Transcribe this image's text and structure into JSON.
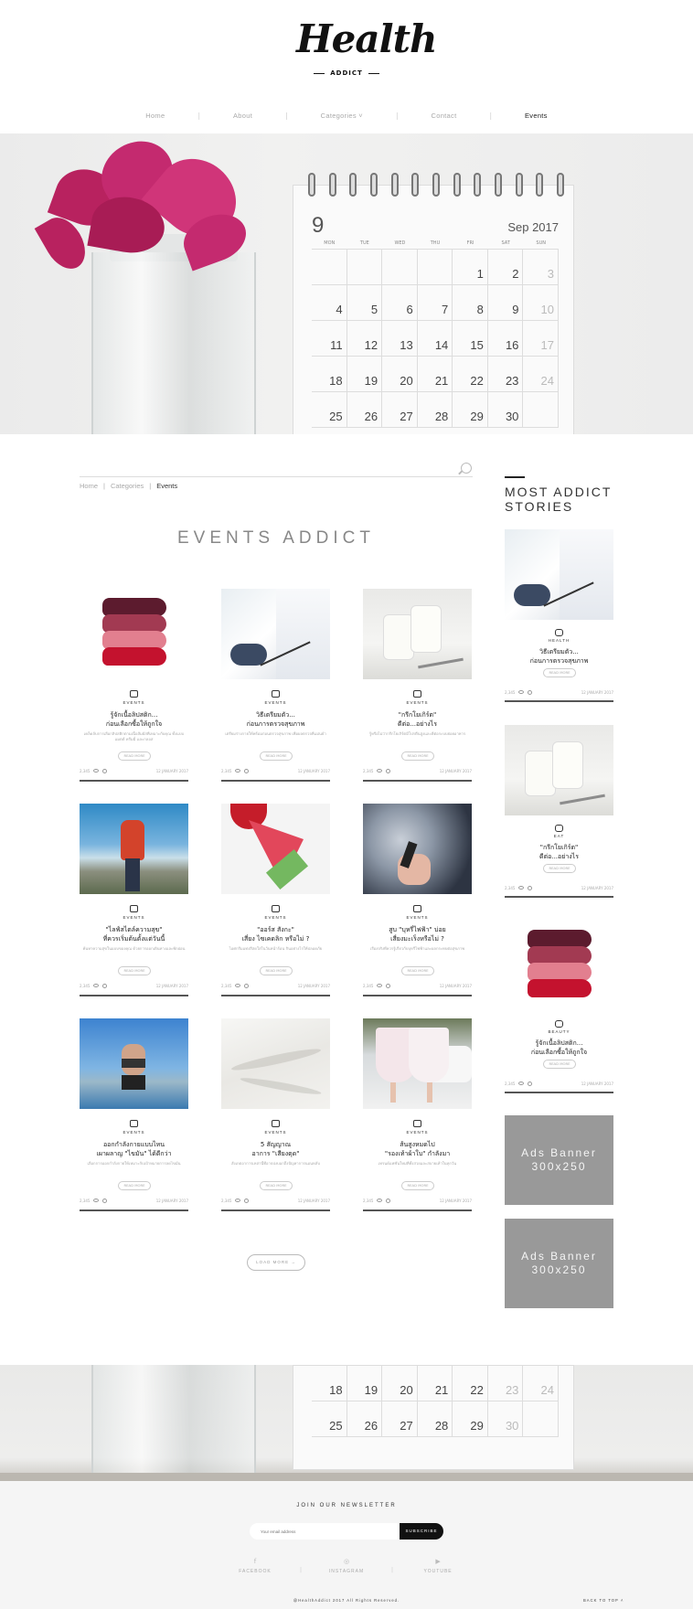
{
  "brand": {
    "logo_script": "Health",
    "logo_sub": "ADDICT"
  },
  "nav": {
    "items": [
      {
        "label": "Home"
      },
      {
        "label": "About"
      },
      {
        "label": "Categories ˅"
      },
      {
        "label": "Contact"
      },
      {
        "label": "Events"
      }
    ],
    "separator": "|",
    "active": "Events"
  },
  "hero": {
    "calendar_number": "9",
    "calendar_month": "Sep 2017",
    "weekdays": [
      "MON",
      "TUE",
      "WED",
      "THU",
      "FRI",
      "SAT",
      "SUN"
    ],
    "days": [
      "",
      "",
      "",
      "",
      "1",
      "2",
      "3",
      "4",
      "5",
      "6",
      "7",
      "8",
      "9",
      "10",
      "11",
      "12",
      "13",
      "14",
      "15",
      "16",
      "17",
      "18",
      "19",
      "20",
      "21",
      "22",
      "23",
      "24",
      "25",
      "26",
      "27",
      "28",
      "29",
      "30",
      ""
    ]
  },
  "breadcrumb": {
    "home": "Home",
    "sep": "|",
    "categories": "Categories",
    "current": "Events"
  },
  "section_title": "EVENTS ADDICT",
  "cards": [
    {
      "category": "EVENTS",
      "title1": "รู้จักเนื้อลิปสติก...",
      "title2": "ก่อนเลือกซื้อให้ถูกใจ",
      "excerpt": "เคล็ดลับการเลือกลิปสติกตามเนื้อสัมผัสที่เหมาะกับคุณ ทั้งแบบแมตต์ ครีมมี่ และกลอส",
      "read": "READ MORE",
      "views": "2,345",
      "date": "12 JANUARY 2017"
    },
    {
      "category": "EVENTS",
      "title1": "วิธีเตรียมตัว...",
      "title2": "ก่อนการตรวจสุขภาพ",
      "excerpt": "เตรียมร่างกายให้พร้อมก่อนตรวจสุขภาพ เพื่อผลตรวจที่แม่นยำ",
      "read": "READ MORE",
      "views": "2,345",
      "date": "12 JANUARY 2017"
    },
    {
      "category": "EVENTS",
      "title1": "\"กรีกโยเกิร์ต\"",
      "title2": "ดีต่อ...อย่างไร",
      "excerpt": "รู้หรือไม่ว่ากรีกโยเกิร์ตมีโปรตีนสูงและดีต่อระบบย่อยอาหาร",
      "read": "READ MORE",
      "views": "2,345",
      "date": "12 JANUARY 2017"
    },
    {
      "category": "EVENTS",
      "title1": "\"ไลฟ์สไตล์ความสุข\"",
      "title2": "ที่ควรเริ่มต้นตั้งแต่วันนี้",
      "excerpt": "ค้นหาความสุขในแบบของคุณ ด้วยการออกเดินทางและพักผ่อน",
      "read": "READ MORE",
      "views": "2,345",
      "date": "12 JANUARY 2017"
    },
    {
      "category": "EVENTS",
      "title1": "\"ออร์ส สังกะ\"",
      "title2": "เสี่ยง ไซเคดลิก หรือไม่ ?",
      "excerpt": "ไอศกรีมแท่งสีสดใสในวันหน้าร้อน กินอย่างไรให้ปลอดภัย",
      "read": "READ MORE",
      "views": "2,345",
      "date": "12 JANUARY 2017"
    },
    {
      "category": "EVENTS",
      "title1": "สูบ \"บุหรี่ไฟฟ้า\" บ่อย",
      "title2": "เสี่ยงมะเร็งหรือไม่ ?",
      "excerpt": "เรื่องจริงที่ควรรู้เกี่ยวกับบุหรี่ไฟฟ้าและผลกระทบต่อสุขภาพ",
      "read": "READ MORE",
      "views": "2,345",
      "date": "12 JANUARY 2017"
    },
    {
      "category": "EVENTS",
      "title1": "ออกกำลังกายแบบไหน",
      "title2": "เผาผลาญ \"ไขมัน\" ได้ดีกว่า",
      "excerpt": "เลือกการออกกำลังกายให้เหมาะกับเป้าหมายการลดไขมัน",
      "read": "READ MORE",
      "views": "2,345",
      "date": "12 JANUARY 2017"
    },
    {
      "category": "EVENTS",
      "title1": "5 สัญญาณ",
      "title2": "อาการ \"เสียงตุด\"",
      "excerpt": "สังเกตอาการเหล่านี้ที่อาจบ่งบอกถึงปัญหาการนอนหลับ",
      "read": "READ MORE",
      "views": "2,345",
      "date": "12 JANUARY 2017"
    },
    {
      "category": "EVENTS",
      "title1": "ส้นสูงหมดไป",
      "title2": "\"รองเท้าผ้าใบ\" กำลังมา",
      "excerpt": "เทรนด์แฟชั่นใหม่ที่ทั้งสวยและสบายเท้าในทุกวัน",
      "read": "READ MORE",
      "views": "2,345",
      "date": "12 JANUARY 2017"
    }
  ],
  "load_more": "LOAD MORE →",
  "sidebar": {
    "title_line1": "MOST ADDICT",
    "title_line2": "STORIES",
    "stories": [
      {
        "category": "HEALTH",
        "title1": "วิธีเตรียมตัว...",
        "title2": "ก่อนการตรวจสุขภาพ",
        "read": "READ MORE",
        "views": "2,345",
        "date": "12 JANUARY 2017"
      },
      {
        "category": "EAT",
        "title1": "\"กรีกโยเกิร์ต\"",
        "title2": "ดีต่อ...อย่างไร",
        "read": "READ MORE",
        "views": "2,345",
        "date": "12 JANUARY 2017"
      },
      {
        "category": "BEAUTY",
        "title1": "รู้จักเนื้อลิปสติก...",
        "title2": "ก่อนเลือกซื้อให้ถูกใจ",
        "read": "READ MORE",
        "views": "2,345",
        "date": "12 JANUARY 2017"
      }
    ],
    "ads": [
      {
        "line1": "Ads Banner",
        "line2": "300x250"
      },
      {
        "line1": "Ads Banner",
        "line2": "300x250"
      }
    ]
  },
  "bottom_calendar_days": [
    "18",
    "19",
    "20",
    "21",
    "22",
    "23",
    "24",
    "25",
    "26",
    "27",
    "28",
    "29",
    "30",
    ""
  ],
  "footer": {
    "newsletter_title": "JOIN OUR NEWSLETTER",
    "email_placeholder": "Your email address",
    "subscribe": "SUBSCRIBE",
    "social": [
      {
        "label": "FACEBOOK",
        "icon": "f"
      },
      {
        "label": "INSTAGRAM",
        "icon": "◎"
      },
      {
        "label": "YOUTUBE",
        "icon": "▶"
      }
    ],
    "copyright": "@HealthAddict 2017 All Rights Reserved.",
    "back_to_top": "BACK TO TOP ˄"
  },
  "colors": {
    "accent": "#222222",
    "ad_bg": "#999999",
    "footer_bg": "#f5f5f5"
  }
}
